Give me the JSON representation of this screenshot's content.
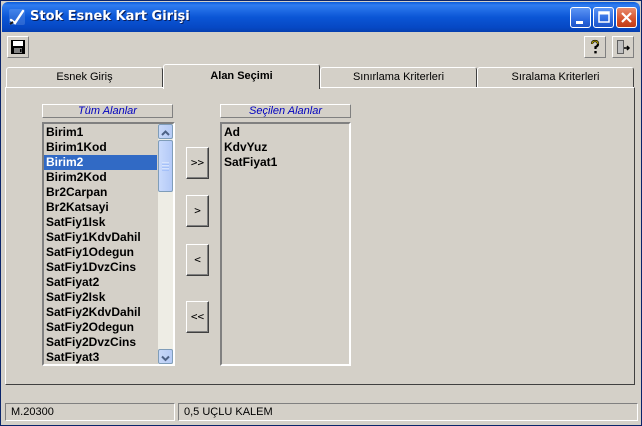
{
  "window": {
    "title": "Stok Esnek Kart Girişi",
    "icons": {
      "app": "checkmark-pen-icon",
      "minimize": "minimize-icon",
      "maximize": "maximize-icon",
      "close": "close-icon"
    }
  },
  "toolbar": {
    "save_icon": "floppy-disk-icon",
    "help_icon": "question-mark-icon",
    "exit_icon": "door-exit-icon"
  },
  "tabs": [
    {
      "label": "Esnek Giriş",
      "active": false
    },
    {
      "label": "Alan Seçimi",
      "active": true
    },
    {
      "label": "Sınırlama Kriterleri",
      "active": false
    },
    {
      "label": "Sıralama Kriterleri",
      "active": false
    }
  ],
  "all_fields": {
    "caption": "Tüm Alanlar",
    "items": [
      "Birim1",
      "Birim1Kod",
      "Birim2",
      "Birim2Kod",
      "Br2Carpan",
      "Br2Katsayi",
      "SatFiy1Isk",
      "SatFiy1KdvDahil",
      "SatFiy1Odegun",
      "SatFiy1DvzCins",
      "SatFiyat2",
      "SatFiy2Isk",
      "SatFiy2KdvDahil",
      "SatFiy2Odegun",
      "SatFiy2DvzCins",
      "SatFiyat3"
    ],
    "selected_item": "Birim2"
  },
  "selected_fields": {
    "caption": "Seçilen Alanlar",
    "items": [
      "Ad",
      "KdvYuz",
      "SatFiyat1"
    ]
  },
  "move_buttons": {
    "add_all": ">>",
    "add_one": ">",
    "remove_one": "<",
    "remove_all": "<<"
  },
  "status": {
    "code": "M.20300",
    "message": "0,5 UÇLU KALEM"
  }
}
